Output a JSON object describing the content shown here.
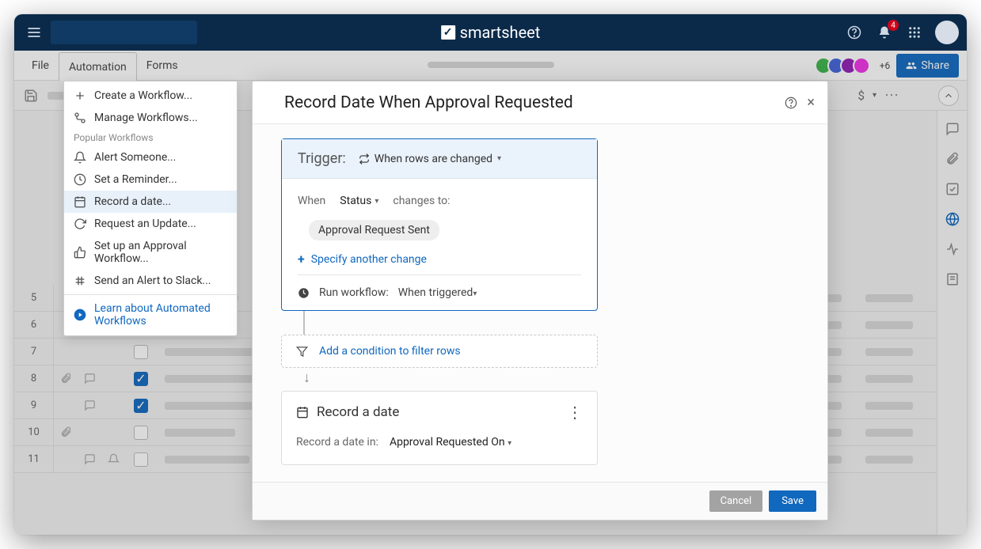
{
  "brand": "smartsheet",
  "topbar": {
    "notification_count": "4"
  },
  "menubar": {
    "items": [
      "File",
      "Automation",
      "Forms"
    ],
    "active_index": 1,
    "plus_count": "+6",
    "share_label": "Share"
  },
  "automation_menu": {
    "items": [
      {
        "label": "Create a Workflow...",
        "icon": "plus"
      },
      {
        "label": "Manage Workflows...",
        "icon": "flow"
      }
    ],
    "section_label": "Popular Workflows",
    "popular": [
      {
        "label": "Alert Someone...",
        "icon": "bell"
      },
      {
        "label": "Set a Reminder...",
        "icon": "clock"
      },
      {
        "label": "Record a date...",
        "icon": "calendar",
        "hovered": true
      },
      {
        "label": "Request an Update...",
        "icon": "refresh"
      },
      {
        "label": "Set up an Approval Workflow...",
        "icon": "thumbs-up"
      },
      {
        "label": "Send an Alert to Slack...",
        "icon": "slack"
      }
    ],
    "learn_label": "Learn about Automated Workflows"
  },
  "modal": {
    "title": "Record Date When Approval Requested",
    "trigger": {
      "label": "Trigger:",
      "type_label": "When rows are changed",
      "when_label": "When",
      "field": "Status",
      "changes_to_label": "changes to:",
      "value_chip": "Approval Request Sent",
      "specify_another": "Specify another change",
      "run_label": "Run workflow:",
      "run_value": "When triggered"
    },
    "condition": {
      "add_label": "Add a condition to filter rows"
    },
    "action": {
      "title": "Record a date",
      "field_label": "Record a date in:",
      "field_value": "Approval Requested On"
    },
    "footer": {
      "cancel": "Cancel",
      "save": "Save"
    }
  },
  "grid": {
    "rows": [
      {
        "num": "5",
        "checked": true,
        "icons": []
      },
      {
        "num": "6",
        "checked": false,
        "icons": [
          "comment",
          "bell"
        ]
      },
      {
        "num": "7",
        "checked": false,
        "icons": []
      },
      {
        "num": "8",
        "checked": true,
        "icons": [
          "attach",
          "comment"
        ]
      },
      {
        "num": "9",
        "checked": true,
        "icons": [
          "comment"
        ]
      },
      {
        "num": "10",
        "checked": false,
        "icons": [
          "attach"
        ]
      },
      {
        "num": "11",
        "checked": false,
        "icons": [
          "comment",
          "bell"
        ]
      }
    ]
  }
}
